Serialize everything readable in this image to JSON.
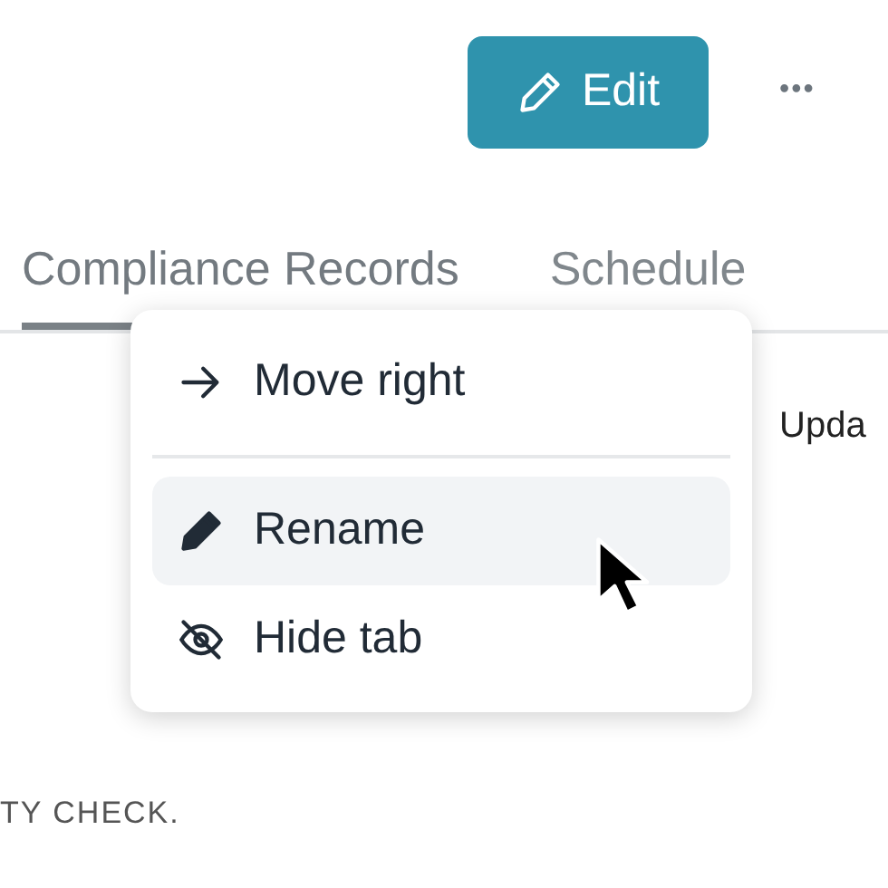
{
  "toolbar": {
    "edit_button": "Edit",
    "more_button": "•••"
  },
  "tabs": [
    {
      "label": "Compliance Records",
      "selected": true
    },
    {
      "label": "Schedule",
      "selected": false
    }
  ],
  "content": {
    "column_text": "Upda",
    "footer_text": "TY CHECK."
  },
  "context_menu": {
    "items": [
      {
        "kind": "arrow",
        "label": "Move right",
        "hovered": false
      },
      {
        "kind": "divider"
      },
      {
        "kind": "pencil",
        "label": "Rename",
        "hovered": true
      },
      {
        "kind": "eye-off",
        "label": "Hide tab",
        "hovered": false
      }
    ]
  }
}
